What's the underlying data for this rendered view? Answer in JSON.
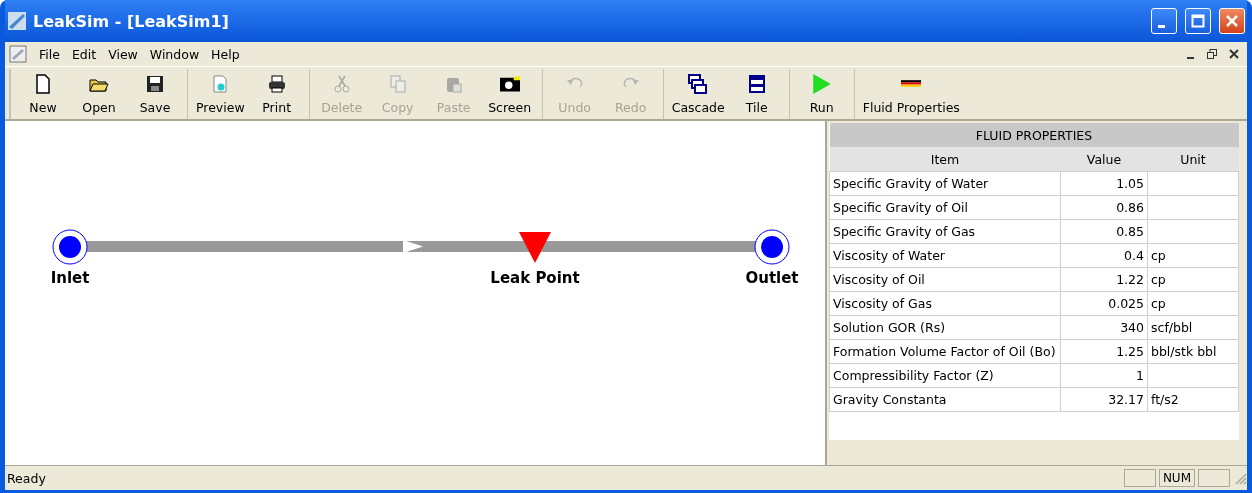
{
  "window": {
    "title": "LeakSim - [LeakSim1]"
  },
  "menu": [
    "File",
    "Edit",
    "View",
    "Window",
    "Help"
  ],
  "toolbar": [
    [
      {
        "label": "New",
        "kind": "new",
        "disabled": false
      },
      {
        "label": "Open",
        "kind": "open",
        "disabled": false
      },
      {
        "label": "Save",
        "kind": "save",
        "disabled": false
      }
    ],
    [
      {
        "label": "Preview",
        "kind": "preview",
        "disabled": false
      },
      {
        "label": "Print",
        "kind": "print",
        "disabled": false
      }
    ],
    [
      {
        "label": "Delete",
        "kind": "cut",
        "disabled": true
      },
      {
        "label": "Copy",
        "kind": "copy",
        "disabled": true
      },
      {
        "label": "Paste",
        "kind": "paste",
        "disabled": true
      },
      {
        "label": "Screen",
        "kind": "camera",
        "disabled": false
      }
    ],
    [
      {
        "label": "Undo",
        "kind": "undo",
        "disabled": true
      },
      {
        "label": "Redo",
        "kind": "redo",
        "disabled": true
      }
    ],
    [
      {
        "label": "Cascade",
        "kind": "cascade",
        "disabled": false
      },
      {
        "label": "Tile",
        "kind": "tile",
        "disabled": false
      }
    ],
    [
      {
        "label": "Run",
        "kind": "run",
        "disabled": false
      }
    ],
    [
      {
        "label": "Fluid Properties",
        "kind": "flag",
        "disabled": false
      }
    ]
  ],
  "diagram": {
    "nodes": [
      {
        "label": "Inlet",
        "kind": "endpoint"
      },
      {
        "label": "Leak Point",
        "kind": "leak"
      },
      {
        "label": "Outlet",
        "kind": "endpoint"
      }
    ]
  },
  "properties": {
    "title": "FLUID PROPERTIES",
    "columns": [
      "Item",
      "Value",
      "Unit"
    ],
    "rows": [
      {
        "item": "Specific Gravity of Water",
        "value": "1.05"
      },
      {
        "item": "Specific Gravity of Oil",
        "value": "0.86"
      },
      {
        "item": "Specific Gravity of Gas",
        "value": "0.85"
      },
      {
        "item": "Viscosity of Water",
        "value": "0.4",
        "unit": "cp"
      },
      {
        "item": "Viscosity of Oil",
        "value": "1.22",
        "unit": "cp"
      },
      {
        "item": "Viscosity of Gas",
        "value": "0.025",
        "unit": "cp"
      },
      {
        "item": "Solution GOR (Rs)",
        "value": "340",
        "unit": "scf/bbl"
      },
      {
        "item": "Formation Volume Factor of Oil (Bo)",
        "value": "1.25",
        "unit": "bbl/stk bbl"
      },
      {
        "item": "Compressibility Factor (Z)",
        "value": "1"
      },
      {
        "item": "Gravity Constanta",
        "value": "32.17",
        "unit": "ft/s2"
      }
    ]
  },
  "status_bar": {
    "message": "Ready",
    "panes": [
      "NUM"
    ]
  }
}
